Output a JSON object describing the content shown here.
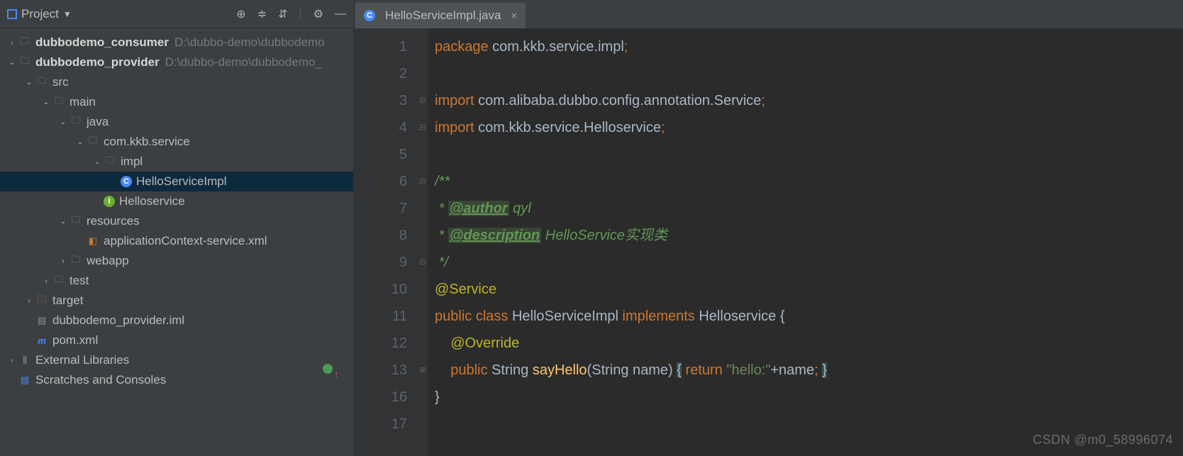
{
  "sidebar": {
    "title": "Project",
    "toolbar_icons": [
      "target-icon",
      "collapse-icon",
      "expand-icon",
      "gear-icon",
      "hide-icon"
    ],
    "rows": [
      {
        "indent": 0,
        "twisty": "›",
        "icon": "folder",
        "label": "dubbodemo_consumer",
        "bold": true,
        "path": "D:\\dubbo-demo\\dubbodemo"
      },
      {
        "indent": 0,
        "twisty": "⌄",
        "icon": "folder",
        "label": "dubbodemo_provider",
        "bold": true,
        "path": "D:\\dubbo-demo\\dubbodemo_"
      },
      {
        "indent": 1,
        "twisty": "⌄",
        "icon": "folder",
        "label": "src"
      },
      {
        "indent": 2,
        "twisty": "⌄",
        "icon": "folder",
        "label": "main"
      },
      {
        "indent": 3,
        "twisty": "⌄",
        "icon": "folder",
        "label": "java"
      },
      {
        "indent": 4,
        "twisty": "⌄",
        "icon": "package",
        "label": "com.kkb.service"
      },
      {
        "indent": 5,
        "twisty": "⌄",
        "icon": "package",
        "label": "impl"
      },
      {
        "indent": 6,
        "twisty": "",
        "icon": "class",
        "label": "HelloServiceImpl",
        "selected": true
      },
      {
        "indent": 5,
        "twisty": "",
        "icon": "interface",
        "label": "Helloservice"
      },
      {
        "indent": 3,
        "twisty": "⌄",
        "icon": "resources",
        "label": "resources"
      },
      {
        "indent": 4,
        "twisty": "",
        "icon": "xml",
        "label": "applicationContext-service.xml"
      },
      {
        "indent": 3,
        "twisty": "›",
        "icon": "webfolder",
        "label": "webapp"
      },
      {
        "indent": 2,
        "twisty": "›",
        "icon": "folder",
        "label": "test"
      },
      {
        "indent": 1,
        "twisty": "›",
        "icon": "folder-orange",
        "label": "target"
      },
      {
        "indent": 1,
        "twisty": "",
        "icon": "file",
        "label": "dubbodemo_provider.iml"
      },
      {
        "indent": 1,
        "twisty": "",
        "icon": "maven",
        "label": "pom.xml"
      },
      {
        "indent": 0,
        "twisty": "›",
        "icon": "lib",
        "label": "External Libraries"
      },
      {
        "indent": 0,
        "twisty": "",
        "icon": "scratch",
        "label": "Scratches and Consoles"
      }
    ]
  },
  "tab": {
    "filename": "HelloServiceImpl.java"
  },
  "gutter": [
    "1",
    "2",
    "3",
    "4",
    "5",
    "6",
    "7",
    "8",
    "9",
    "10",
    "11",
    "12",
    "13",
    "16",
    "17"
  ],
  "code_lines": [
    {
      "n": "1",
      "tokens": [
        [
          "kw",
          "package "
        ],
        [
          "pkg",
          "com.kkb.service.impl"
        ],
        [
          "semi",
          ";"
        ]
      ]
    },
    {
      "n": "2",
      "tokens": []
    },
    {
      "n": "3",
      "tokens": [
        [
          "kw",
          "import "
        ],
        [
          "pkg",
          "com.alibaba.dubbo.config.annotation."
        ],
        [
          "type-svc",
          "Service"
        ],
        [
          "semi",
          ";"
        ]
      ]
    },
    {
      "n": "4",
      "tokens": [
        [
          "kw",
          "import "
        ],
        [
          "pkg",
          "com.kkb.service.Helloservice"
        ],
        [
          "semi",
          ";"
        ]
      ]
    },
    {
      "n": "5",
      "tokens": []
    },
    {
      "n": "6",
      "tokens": [
        [
          "comment",
          "/**"
        ]
      ]
    },
    {
      "n": "7",
      "tokens": [
        [
          "comment",
          " * "
        ],
        [
          "doctag",
          "@author"
        ],
        [
          "comment",
          " qyl"
        ]
      ]
    },
    {
      "n": "8",
      "tokens": [
        [
          "comment",
          " * "
        ],
        [
          "doctag",
          "@description"
        ],
        [
          "comment",
          " HelloService实现类"
        ]
      ]
    },
    {
      "n": "9",
      "tokens": [
        [
          "comment",
          " */"
        ]
      ]
    },
    {
      "n": "10",
      "tokens": [
        [
          "anno",
          "@Service"
        ]
      ]
    },
    {
      "n": "11",
      "tokens": [
        [
          "kw",
          "public class "
        ],
        [
          "type",
          "HelloServiceImpl "
        ],
        [
          "kw",
          "implements "
        ],
        [
          "type",
          "Helloservice "
        ],
        [
          "punct",
          "{"
        ]
      ]
    },
    {
      "n": "12",
      "tokens": [
        [
          "plain",
          "    "
        ],
        [
          "override",
          "@Override"
        ]
      ]
    },
    {
      "n": "13",
      "tokens": [
        [
          "plain",
          "    "
        ],
        [
          "kw",
          "public "
        ],
        [
          "type",
          "String "
        ],
        [
          "method",
          "sayHello"
        ],
        [
          "punct",
          "(String name) "
        ],
        [
          "hl-brace",
          "{"
        ],
        [
          "punct",
          " "
        ],
        [
          "kw",
          "return "
        ],
        [
          "str",
          "\"hello:\""
        ],
        [
          "punct",
          "+name"
        ],
        [
          "semi",
          ";"
        ],
        [
          "punct",
          " "
        ],
        [
          "hl-brace",
          "}"
        ]
      ]
    },
    {
      "n": "16",
      "tokens": [
        [
          "punct",
          "}"
        ]
      ]
    },
    {
      "n": "17",
      "tokens": []
    }
  ],
  "fold_marks": {
    "3": "⊟",
    "4": "⊟",
    "6": "⊟",
    "9": "⊟",
    "13": "⊞"
  },
  "watermark": "CSDN @m0_58996074"
}
